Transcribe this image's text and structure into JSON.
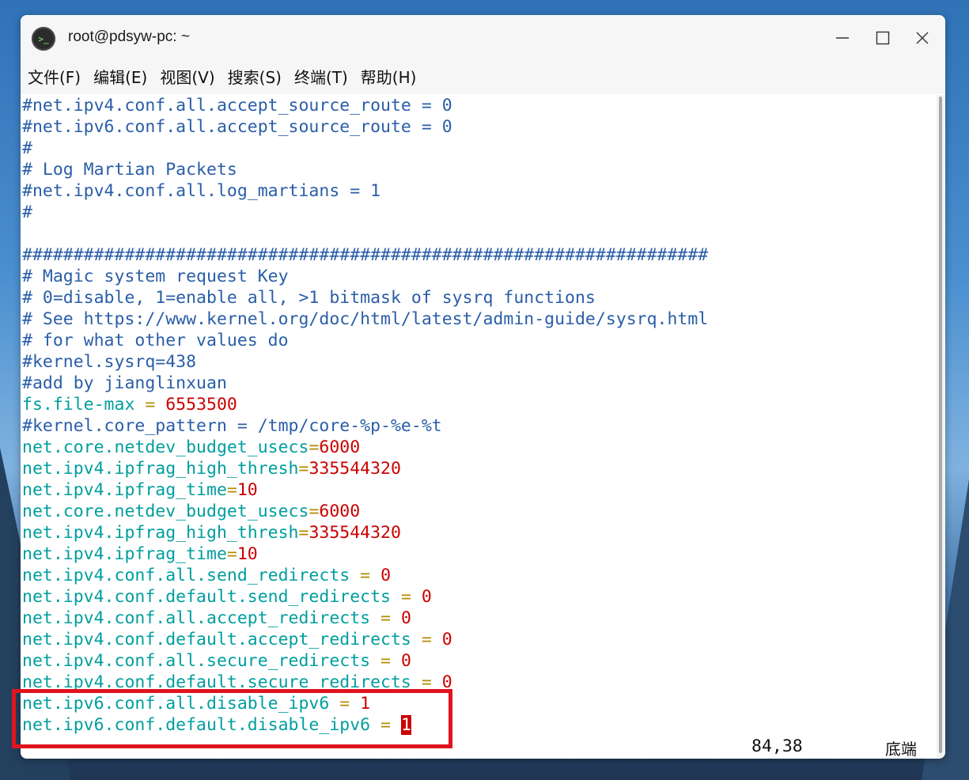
{
  "window": {
    "title": "root@pdsyw-pc: ~",
    "icon_glyph": ">_",
    "app_icon": "terminal-icon"
  },
  "menu": [
    {
      "label": "文件(F)"
    },
    {
      "label": "编辑(E)"
    },
    {
      "label": "视图(V)"
    },
    {
      "label": "搜索(S)"
    },
    {
      "label": "终端(T)"
    },
    {
      "label": "帮助(H)"
    }
  ],
  "colors": {
    "comment": "#2a5ea7",
    "key": "#009e9e",
    "operator": "#b38b00",
    "value": "#cc0000",
    "highlight_border": "#e0141e"
  },
  "lines": [
    {
      "type": "comment",
      "text": "#net.ipv4.conf.all.accept_source_route = 0"
    },
    {
      "type": "comment",
      "text": "#net.ipv6.conf.all.accept_source_route = 0"
    },
    {
      "type": "comment",
      "text": "#"
    },
    {
      "type": "comment",
      "text": "# Log Martian Packets"
    },
    {
      "type": "comment",
      "text": "#net.ipv4.conf.all.log_martians = 1"
    },
    {
      "type": "comment",
      "text": "#"
    },
    {
      "type": "blank",
      "text": ""
    },
    {
      "type": "comment",
      "text": "###################################################################"
    },
    {
      "type": "comment",
      "text": "# Magic system request Key"
    },
    {
      "type": "comment",
      "text": "# 0=disable, 1=enable all, >1 bitmask of sysrq functions"
    },
    {
      "type": "comment",
      "text": "# See https://www.kernel.org/doc/html/latest/admin-guide/sysrq.html"
    },
    {
      "type": "comment",
      "text": "# for what other values do"
    },
    {
      "type": "comment",
      "text": "#kernel.sysrq=438"
    },
    {
      "type": "comment",
      "text": "#add by jianglinxuan"
    },
    {
      "type": "setting",
      "key": "fs.file-max",
      "op": " = ",
      "value": "6553500"
    },
    {
      "type": "comment",
      "text": "#kernel.core_pattern = /tmp/core-%p-%e-%t"
    },
    {
      "type": "setting",
      "key": "net.core.netdev_budget_usecs",
      "op": "=",
      "value": "6000"
    },
    {
      "type": "setting",
      "key": "net.ipv4.ipfrag_high_thresh",
      "op": "=",
      "value": "335544320"
    },
    {
      "type": "setting",
      "key": "net.ipv4.ipfrag_time",
      "op": "=",
      "value": "10"
    },
    {
      "type": "setting",
      "key": "net.core.netdev_budget_usecs",
      "op": "=",
      "value": "6000"
    },
    {
      "type": "setting",
      "key": "net.ipv4.ipfrag_high_thresh",
      "op": "=",
      "value": "335544320"
    },
    {
      "type": "setting",
      "key": "net.ipv4.ipfrag_time",
      "op": "=",
      "value": "10"
    },
    {
      "type": "setting",
      "key": "net.ipv4.conf.all.send_redirects",
      "op": " = ",
      "value": "0"
    },
    {
      "type": "setting",
      "key": "net.ipv4.conf.default.send_redirects",
      "op": " = ",
      "value": "0"
    },
    {
      "type": "setting",
      "key": "net.ipv4.conf.all.accept_redirects",
      "op": " = ",
      "value": "0"
    },
    {
      "type": "setting",
      "key": "net.ipv4.conf.default.accept_redirects",
      "op": " = ",
      "value": "0"
    },
    {
      "type": "setting",
      "key": "net.ipv4.conf.all.secure_redirects",
      "op": " = ",
      "value": "0"
    },
    {
      "type": "setting",
      "key": "net.ipv4.conf.default.secure_redirects",
      "op": " = ",
      "value": "0"
    },
    {
      "type": "setting",
      "key": "net.ipv6.conf.all.disable_ipv6",
      "op": " = ",
      "value": "1"
    },
    {
      "type": "setting",
      "key": "net.ipv6.conf.default.disable_ipv6",
      "op": " = ",
      "value": "1",
      "cursor": true
    }
  ],
  "status": {
    "position": "84,38",
    "mode": "底端"
  }
}
